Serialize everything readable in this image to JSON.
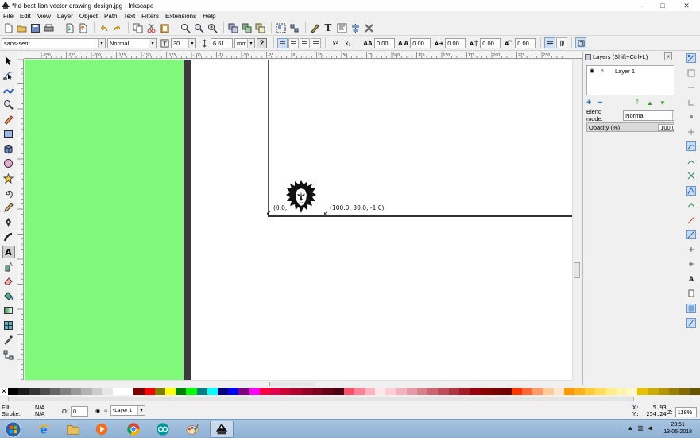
{
  "window": {
    "title": "*hd-best-lion-vector-drawing-design.jpg - Inkscape",
    "controls": [
      "–",
      "□",
      "✕"
    ]
  },
  "menubar": [
    "File",
    "Edit",
    "View",
    "Layer",
    "Object",
    "Path",
    "Text",
    "Filters",
    "Extensions",
    "Help"
  ],
  "text_toolbar": {
    "font_family": "sans-serif",
    "font_style": "Normal",
    "font_size": "30",
    "line_spacing": "6.61",
    "unit": "mm",
    "letter_spacing": "0.00",
    "word_spacing": "0.00",
    "kerning_h": "0.00",
    "kerning_v": "0.00",
    "rotation": "0.00",
    "help": "?",
    "labels": {
      "aa": "AA",
      "wa": "A A",
      "x2": "x²",
      "x_2": "x₂"
    }
  },
  "tools": [
    "selector-tool",
    "node-tool",
    "tweak-tool",
    "zoom-tool",
    "measure-tool",
    "rectangle-tool",
    "3d-box-tool",
    "ellipse-tool",
    "star-tool",
    "spiral-tool",
    "pencil-tool",
    "pen-tool",
    "calligraphy-tool",
    "text-tool",
    "spray-tool",
    "eraser-tool",
    "paint-bucket-tool",
    "gradient-tool",
    "mesh-tool",
    "dropper-tool",
    "connector-tool"
  ],
  "active_tool": "text-tool",
  "ruler_labels": [
    "-250",
    "-225",
    "-200",
    "-175",
    "-150",
    "-125",
    "-100",
    "-75",
    "-50",
    "-25",
    "0",
    "25",
    "50",
    "75",
    "100",
    "125",
    "150",
    "175",
    "200",
    "225",
    "250"
  ],
  "canvas": {
    "measure_start_label": "(0.0; ",
    "measure_end_label": "(100.0; 30.0; -1.0)",
    "green": "#80f97b",
    "dark_strip": "#3a3a3a"
  },
  "layers_panel": {
    "title": "Layers (Shift+Ctrl+L)",
    "layers": [
      {
        "name": "Layer 1"
      }
    ],
    "blend_label": "Blend mode:",
    "blend_value": "Normal",
    "opacity_label": "Opacity (%)",
    "opacity_value": "100.0"
  },
  "palette": [
    "#000000",
    "#1a1a1a",
    "#333333",
    "#4d4d4d",
    "#666666",
    "#808080",
    "#999999",
    "#b3b3b3",
    "#cccccc",
    "#e6e6e6",
    "#ffffff",
    "#ffffff",
    "#800000",
    "#ff0000",
    "#808000",
    "#ffff00",
    "#008000",
    "#00ff00",
    "#008080",
    "#00ffff",
    "#000080",
    "#0000ff",
    "#800080",
    "#ff00ff",
    "#ff0040",
    "#e6004c",
    "#cc0033",
    "#b3002d",
    "#990026",
    "#800020",
    "#660019",
    "#4d0013",
    "#ff4d6a",
    "#ff8095",
    "#ffb3bf",
    "#ffe6ea",
    "#ffccd5",
    "#f2b3bf",
    "#e699a6",
    "#d9808c",
    "#cc6673",
    "#bf4d59",
    "#b33340",
    "#a61a26",
    "#99000d",
    "#8c0000",
    "#800000",
    "#730000",
    "#ff3300",
    "#ff6633",
    "#ff9966",
    "#ffcc99",
    "#ffe6cc",
    "#ff9900",
    "#ffb31a",
    "#ffcc33",
    "#ffdd55",
    "#ffee88",
    "#fff3aa",
    "#fff8cc",
    "#e6c200",
    "#ccac00",
    "#b39600",
    "#998000",
    "#806b00",
    "#665500"
  ],
  "status": {
    "fill_label": "Fill:",
    "stroke_label": "Stroke:",
    "fill_value": "N/A",
    "stroke_value": "N/A",
    "opacity_label": "O:",
    "opacity_value": "0",
    "layer": "•Layer 1",
    "x_label": "X:",
    "y_label": "Y:",
    "x_value": "5.93",
    "y_value": "254.24",
    "zoom_label": "Z:",
    "zoom_value": "118%"
  },
  "taskbar": {
    "apps": [
      "start-button",
      "internet-explorer",
      "file-explorer",
      "media-player",
      "chrome",
      "arduino",
      "paint",
      "inkscape"
    ],
    "time": "23:51",
    "date": "13-05-2018"
  }
}
